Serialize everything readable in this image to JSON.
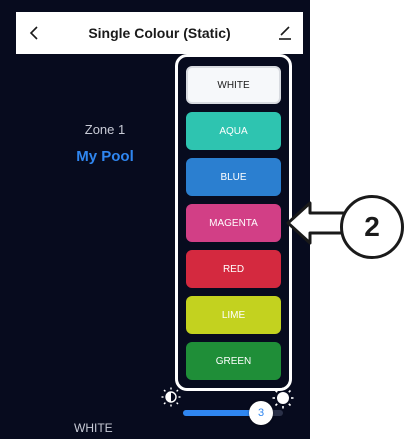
{
  "header": {
    "title": "Single Colour (Static)",
    "back_icon": "chevron-left-icon",
    "edit_icon": "edit-icon"
  },
  "zone": {
    "label": "Zone 1",
    "name": "My Pool"
  },
  "colors": [
    {
      "label": "WHITE",
      "color": "#f6f8fa"
    },
    {
      "label": "AQUA",
      "color": "#2ec4b0"
    },
    {
      "label": "BLUE",
      "color": "#2b7fd0"
    },
    {
      "label": "MAGENTA",
      "color": "#d23f86"
    },
    {
      "label": "RED",
      "color": "#d4293f"
    },
    {
      "label": "LIME",
      "color": "#c3d21f"
    },
    {
      "label": "GREEN",
      "color": "#1f8e38"
    }
  ],
  "brightness": {
    "value": "3",
    "fraction": 0.78
  },
  "footer": {
    "selected_label": "WHITE"
  },
  "callout": {
    "number": "2"
  }
}
